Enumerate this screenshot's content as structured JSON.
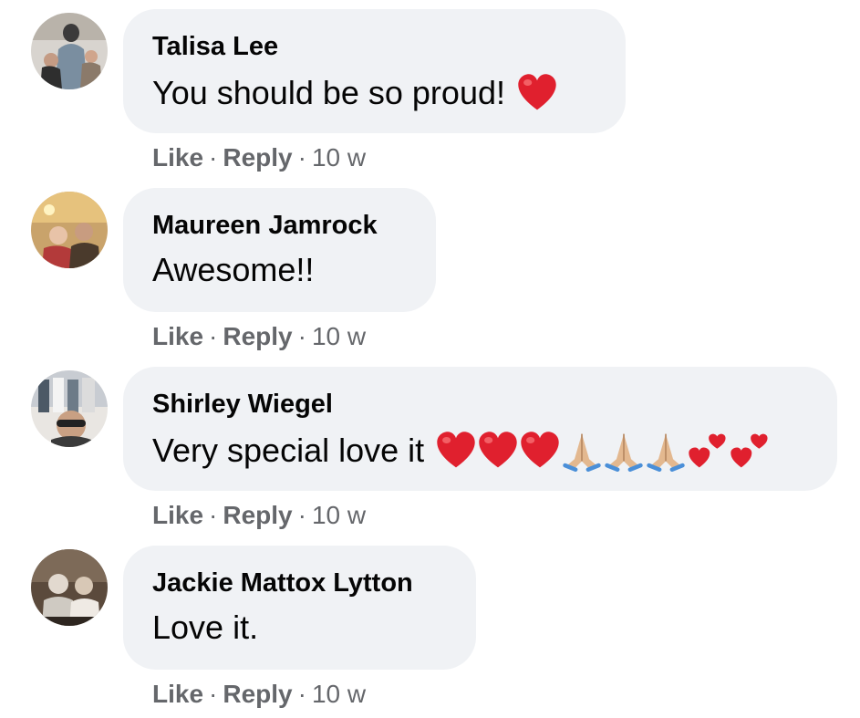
{
  "comments": [
    {
      "author": "Talisa Lee",
      "text": "You should be so proud!",
      "emojis": [
        "red-heart"
      ],
      "like": "Like",
      "reply": "Reply",
      "time": "10 w",
      "avatar_colors": [
        "#d8d4cf",
        "#7a8ea0",
        "#3b3a3a"
      ]
    },
    {
      "author": "Maureen Jamrock",
      "text": "Awesome!!",
      "emojis": [],
      "like": "Like",
      "reply": "Reply",
      "time": "10 w",
      "avatar_colors": [
        "#c9a36b",
        "#b33a3a",
        "#4a3a2c"
      ]
    },
    {
      "author": "Shirley Wiegel",
      "text": "Very special love it",
      "emojis": [
        "red-heart",
        "red-heart",
        "red-heart",
        "folded-hands",
        "folded-hands",
        "folded-hands",
        "two-hearts",
        "two-hearts"
      ],
      "like": "Like",
      "reply": "Reply",
      "time": "10 w",
      "avatar_colors": [
        "#e9e6e2",
        "#4c5966",
        "#222222"
      ]
    },
    {
      "author": "Jackie Mattox Lytton",
      "text": "Love it.",
      "emojis": [],
      "like": "Like",
      "reply": "Reply",
      "time": "10 w",
      "avatar_colors": [
        "#5b4a3c",
        "#cfcac2",
        "#2e2620"
      ]
    }
  ],
  "colors": {
    "bubble": "#f0f2f5",
    "name": "#050505",
    "meta": "#65676b",
    "heart": "#e0202e"
  }
}
